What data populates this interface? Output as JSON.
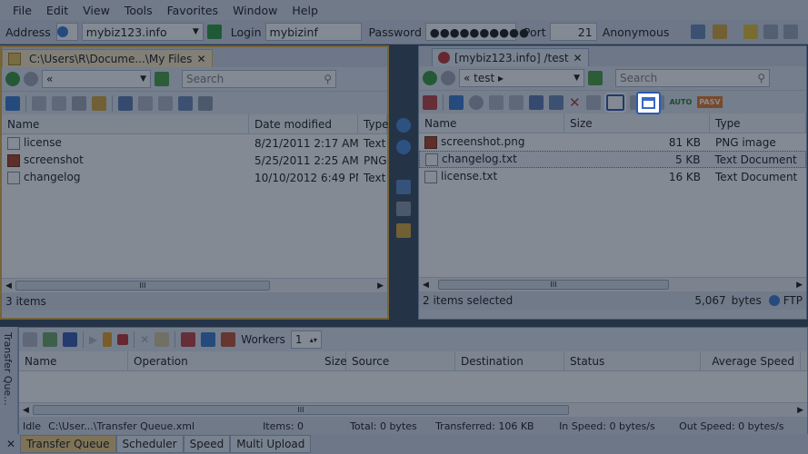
{
  "menu": [
    "File",
    "Edit",
    "View",
    "Tools",
    "Favorites",
    "Window",
    "Help"
  ],
  "connection": {
    "address_label": "Address",
    "address_value": "mybiz123.info",
    "login_label": "Login",
    "login_value": "mybizinf",
    "password_label": "Password",
    "password_value": "●●●●●●●●●●",
    "port_label": "Port",
    "port_value": "21",
    "anonymous_label": "Anonymous"
  },
  "left": {
    "tab": "C:\\Users\\R\\Docume...\\My Files",
    "path": "«",
    "search_placeholder": "Search",
    "columns": [
      "Name",
      "Date modified",
      "Type"
    ],
    "files": [
      {
        "name": "license",
        "date": "8/21/2011 2:17 AM",
        "type": "Text",
        "icon": "text-file-icon"
      },
      {
        "name": "screenshot",
        "date": "5/25/2011 2:25 AM",
        "type": "PNG",
        "icon": "image-file-icon"
      },
      {
        "name": "changelog",
        "date": "10/10/2012 6:49 PM",
        "type": "Text",
        "icon": "text-file-icon"
      }
    ],
    "status": "3 items"
  },
  "right": {
    "tab": "[mybiz123.info] /test",
    "path": "« test ▸",
    "search_placeholder": "Search",
    "columns": [
      "Name",
      "Size",
      "Type"
    ],
    "files": [
      {
        "name": "screenshot.png",
        "size": "81 KB",
        "type": "PNG image",
        "icon": "image-file-icon"
      },
      {
        "name": "changelog.txt",
        "size": "5 KB",
        "type": "Text Document",
        "icon": "text-file-icon"
      },
      {
        "name": "license.txt",
        "size": "16 KB",
        "type": "Text Document",
        "icon": "text-file-icon"
      }
    ],
    "status": "2 items selected",
    "bytes": "5,067",
    "bytes_unit": "bytes",
    "protocol": "FTP",
    "pasv": "PASV",
    "auto": "AUTO"
  },
  "queue": {
    "workers_label": "Workers",
    "workers_value": "1",
    "side_label": "Transfer Que...",
    "columns": [
      "Name",
      "Operation",
      "Size",
      "Source",
      "Destination",
      "Status",
      "Average Speed"
    ],
    "status": {
      "idle": "Idle",
      "file": "C:\\User...\\Transfer Queue.xml",
      "items": "Items: 0",
      "total": "Total: 0 bytes",
      "transferred": "Transferred: 106 KB",
      "in_speed": "In Speed: 0 bytes/s",
      "out_speed": "Out Speed: 0 bytes/s"
    },
    "tabs": [
      "Transfer Queue",
      "Scheduler",
      "Speed",
      "Multi Upload"
    ]
  },
  "scroll_mark": "III"
}
